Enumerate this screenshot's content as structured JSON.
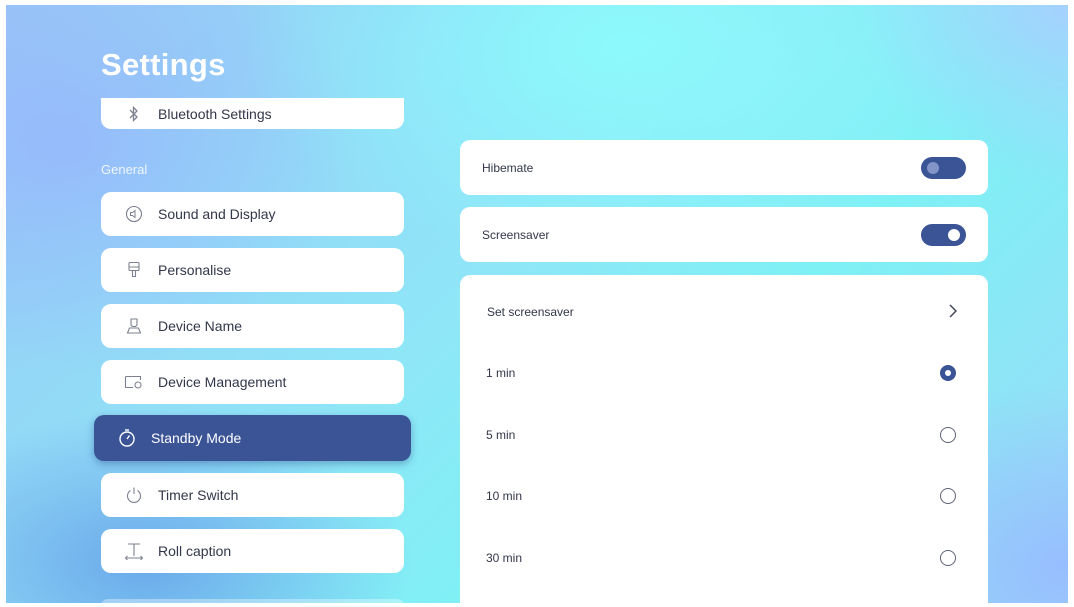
{
  "header": {
    "title": "Settings"
  },
  "sidebar": {
    "top_item": {
      "label": "Bluetooth Settings",
      "icon": "bluetooth-icon"
    },
    "section_label": "General",
    "items": [
      {
        "label": "Sound and Display",
        "icon": "sound-display-icon",
        "active": false
      },
      {
        "label": "Personalise",
        "icon": "brush-icon",
        "active": false
      },
      {
        "label": "Device Name",
        "icon": "person-icon",
        "active": false
      },
      {
        "label": "Device Management",
        "icon": "device-management-icon",
        "active": false
      },
      {
        "label": "Standby Mode",
        "icon": "timer-icon",
        "active": true
      },
      {
        "label": "Timer Switch",
        "icon": "power-icon",
        "active": false
      },
      {
        "label": "Roll caption",
        "icon": "caption-icon",
        "active": false
      }
    ]
  },
  "panel": {
    "hibernate": {
      "label": "Hibemate",
      "enabled": false
    },
    "screensaver": {
      "label": "Screensaver",
      "enabled": true
    },
    "set_screensaver": {
      "label": "Set screensaver",
      "icon": "chevron-right-icon"
    },
    "options": [
      {
        "label": "1 min",
        "selected": true
      },
      {
        "label": "5 min",
        "selected": false
      },
      {
        "label": "10 min",
        "selected": false
      },
      {
        "label": "30 min",
        "selected": false
      }
    ]
  },
  "colors": {
    "accent": "#3b5496",
    "card": "#ffffff",
    "text": "#33364a"
  }
}
